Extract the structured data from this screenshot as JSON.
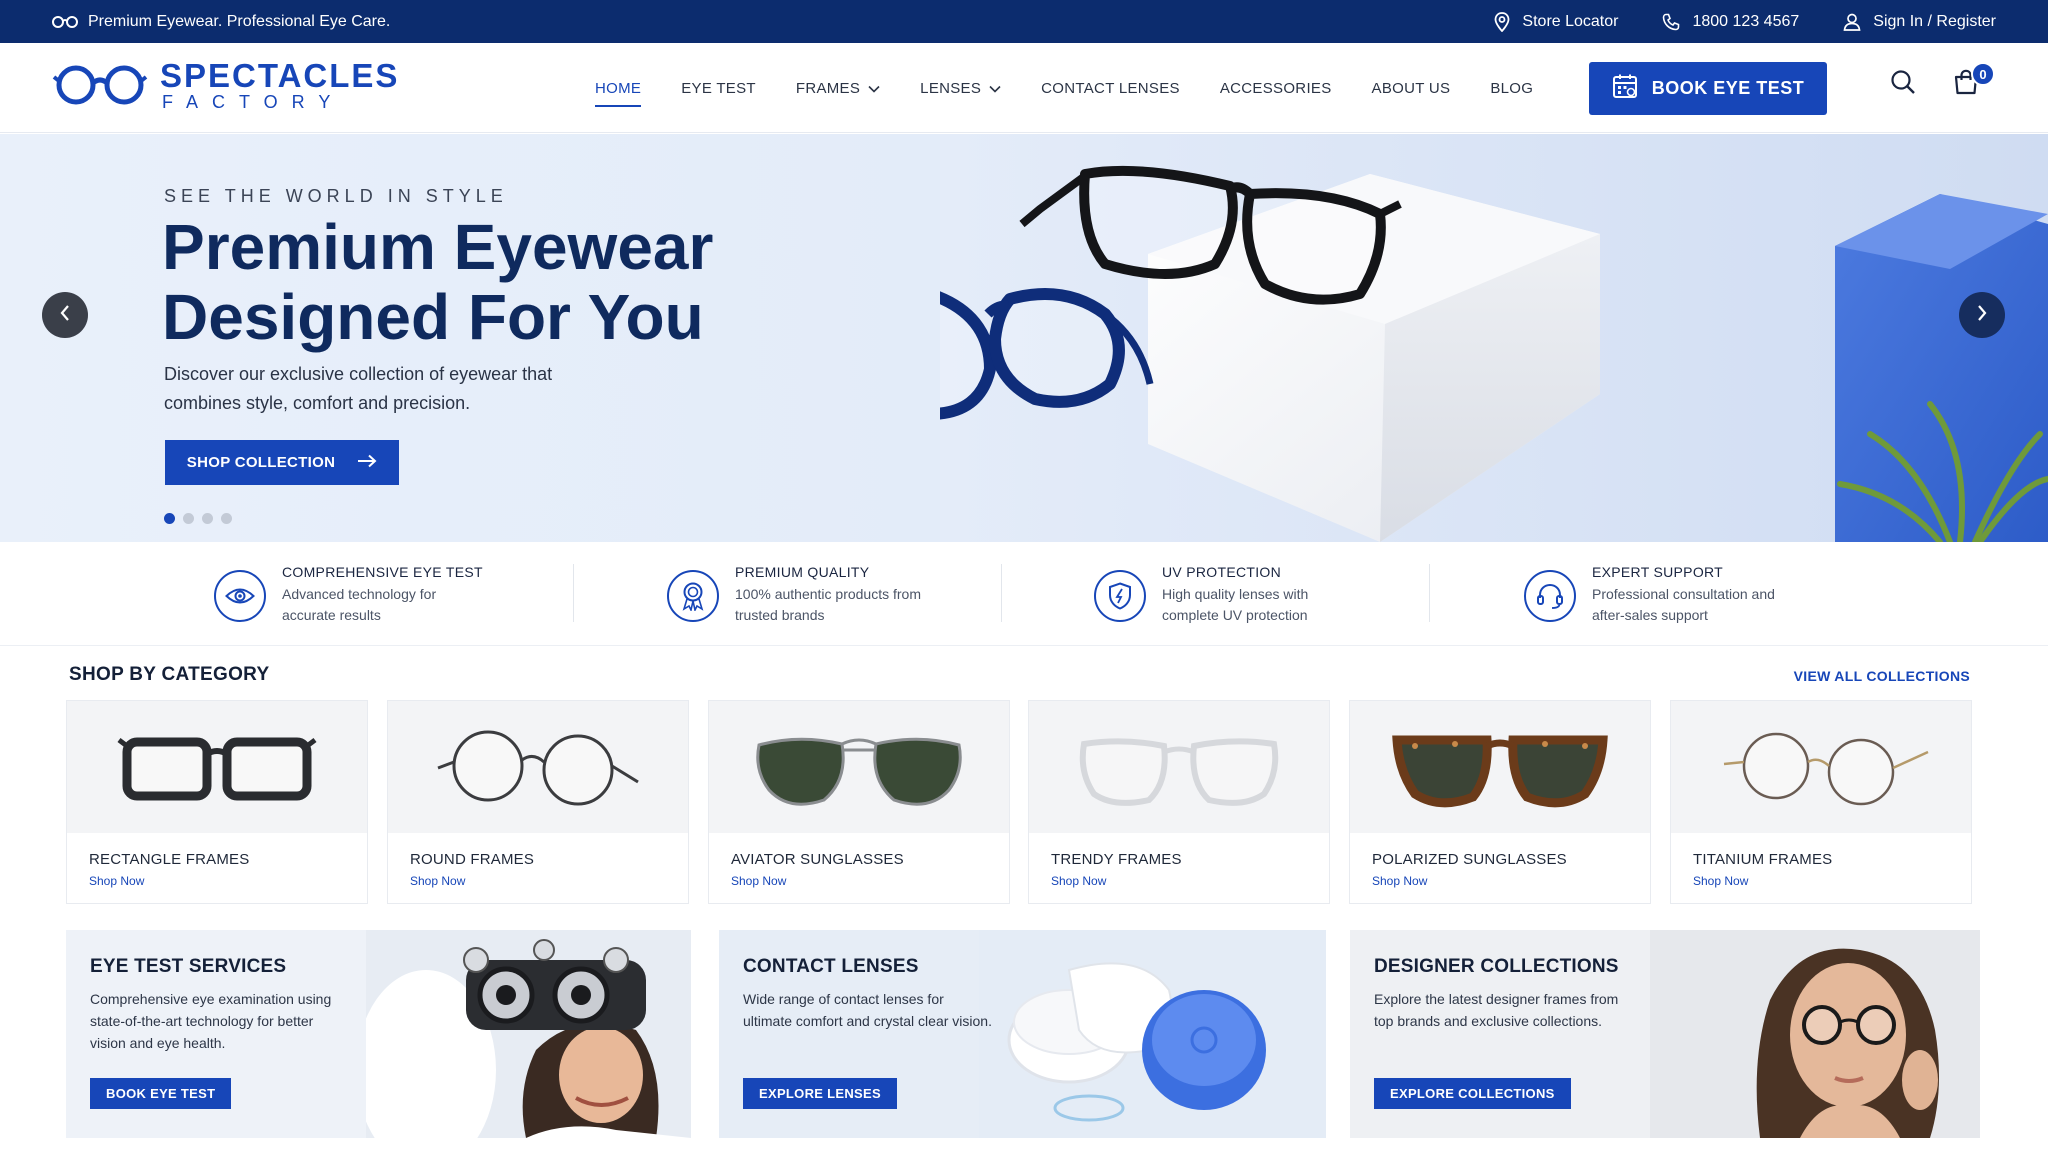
{
  "topbar": {
    "tagline": "Premium Eyewear. Professional Eye Care.",
    "store_locator": "Store Locator",
    "phone": "1800 123 4567",
    "signin": "Sign In / Register"
  },
  "brand": {
    "name": "SPECTACLES",
    "sub": "FACTORY",
    "color": "#1746b8"
  },
  "nav": {
    "items": [
      {
        "label": "HOME",
        "active": true
      },
      {
        "label": "EYE TEST"
      },
      {
        "label": "FRAMES",
        "dropdown": true
      },
      {
        "label": "LENSES",
        "dropdown": true
      },
      {
        "label": "CONTACT LENSES"
      },
      {
        "label": "ACCESSORIES"
      },
      {
        "label": "ABOUT US"
      },
      {
        "label": "BLOG"
      }
    ],
    "book_button": "BOOK EYE TEST",
    "cart_count": "0"
  },
  "hero": {
    "eyebrow": "SEE THE WORLD IN STYLE",
    "title": "Premium Eyewear Designed For You",
    "description": "Discover our exclusive collection of eyewear that combines style, comfort and precision.",
    "cta": "SHOP COLLECTION",
    "slide_count": 4,
    "active_slide": 1
  },
  "features": [
    {
      "title": "COMPREHENSIVE EYE TEST",
      "desc": "Advanced technology for accurate results",
      "icon": "eye-icon"
    },
    {
      "title": "PREMIUM QUALITY",
      "desc": "100% authentic products from trusted brands",
      "icon": "award-icon"
    },
    {
      "title": "UV PROTECTION",
      "desc": "High quality lenses with complete UV protection",
      "icon": "shield-icon"
    },
    {
      "title": "EXPERT SUPPORT",
      "desc": "Professional consultation and after-sales support",
      "icon": "headset-icon"
    }
  ],
  "categories": {
    "title": "SHOP BY CATEGORY",
    "view_all": "VIEW ALL COLLECTIONS",
    "items": [
      {
        "name": "RECTANGLE FRAMES",
        "link": "Shop Now"
      },
      {
        "name": "ROUND FRAMES",
        "link": "Shop Now"
      },
      {
        "name": "AVIATOR SUNGLASSES",
        "link": "Shop Now"
      },
      {
        "name": "TRENDY FRAMES",
        "link": "Shop Now"
      },
      {
        "name": "POLARIZED SUNGLASSES",
        "link": "Shop Now"
      },
      {
        "name": "TITANIUM FRAMES",
        "link": "Shop Now"
      }
    ]
  },
  "promos": [
    {
      "title": "EYE TEST SERVICES",
      "desc": "Comprehensive eye examination using state-of-the-art technology for better vision and eye health.",
      "button": "BOOK EYE TEST"
    },
    {
      "title": "CONTACT LENSES",
      "desc": "Wide range of contact lenses for ultimate comfort and crystal clear vision.",
      "button": "EXPLORE LENSES"
    },
    {
      "title": "DESIGNER COLLECTIONS",
      "desc": "Explore the latest designer frames from top brands and exclusive collections.",
      "button": "EXPLORE COLLECTIONS"
    }
  ]
}
